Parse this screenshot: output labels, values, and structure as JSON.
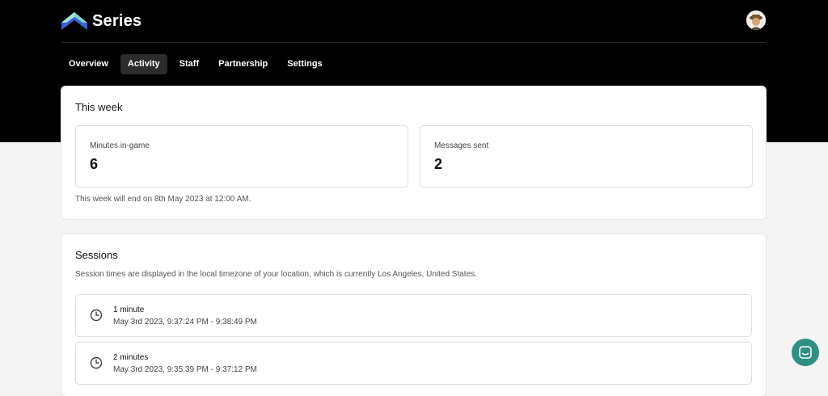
{
  "app": {
    "name": "Series"
  },
  "nav": {
    "tabs": [
      {
        "label": "Overview"
      },
      {
        "label": "Activity"
      },
      {
        "label": "Staff"
      },
      {
        "label": "Partnership"
      },
      {
        "label": "Settings"
      }
    ],
    "active": "Activity"
  },
  "week": {
    "title": "This week",
    "stats": [
      {
        "label": "Minutes in-game",
        "value": "6"
      },
      {
        "label": "Messages sent",
        "value": "2"
      }
    ],
    "note": "This week will end on 8th May 2023 at 12:00 AM."
  },
  "sessions": {
    "title": "Sessions",
    "note": "Session times are displayed in the local timezone of your location, which is currently Los Angeles, United States.",
    "items": [
      {
        "duration": "1 minute",
        "time": "May 3rd 2023, 9:37:24 PM - 9:38:49 PM"
      },
      {
        "duration": "2 minutes",
        "time": "May 3rd 2023, 9:35:39 PM - 9:37:12 PM"
      }
    ]
  },
  "colors": {
    "accent": "#2f8f83",
    "logo_top": "#7ed3c8",
    "logo_bottom": "#3b5fd6"
  },
  "icons": {
    "logo": "series-logo-icon",
    "avatar": "user-avatar",
    "clock": "clock-icon",
    "chat": "chat-icon"
  }
}
